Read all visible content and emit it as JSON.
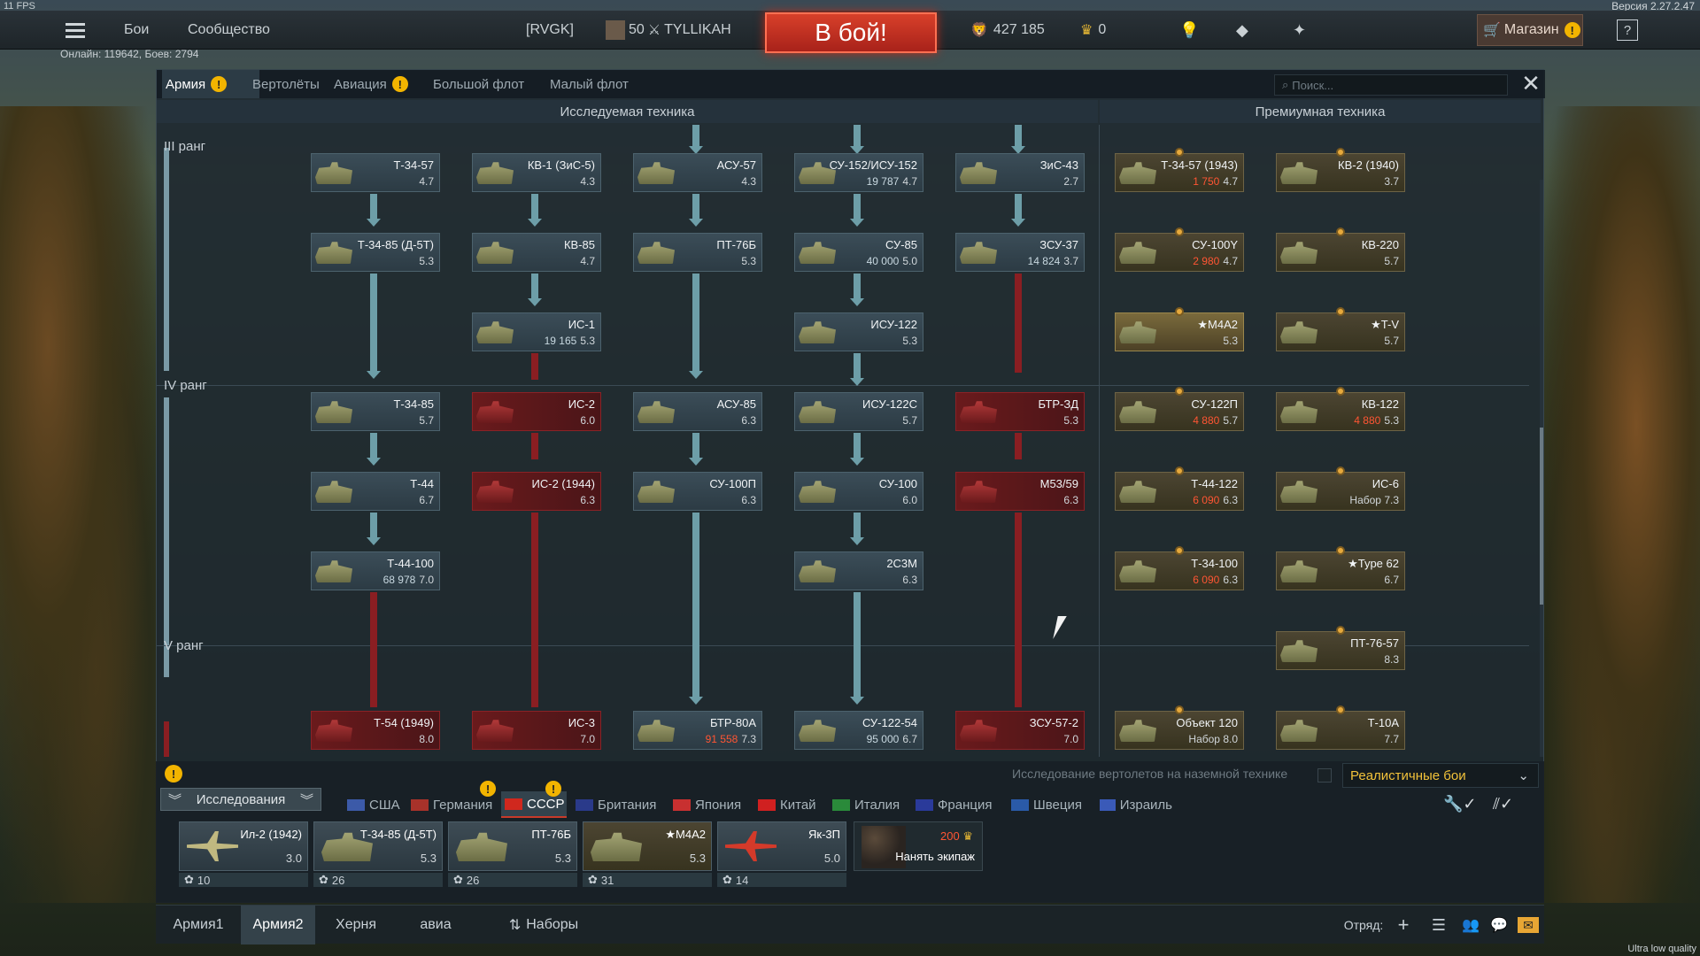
{
  "fps": "11 FPS",
  "version": "Версия 2.27.2.47",
  "topbar": {
    "battles": "Бои",
    "community": "Сообщество",
    "squad_tag": "[RVGK]",
    "level": "50",
    "nickname": "TYLLIKAH",
    "to_battle": "В бой!",
    "silver_lions": "427 185",
    "golden_eagles": "0",
    "shop": "Магазин",
    "help": "?"
  },
  "online": "Онлайн: 119642, Боев: 2794",
  "tabs": [
    {
      "label": "Армия",
      "active": true,
      "warn": true
    },
    {
      "label": "Вертолёты",
      "active": false,
      "warn": false
    },
    {
      "label": "Авиация",
      "active": false,
      "warn": true
    },
    {
      "label": "Большой флот",
      "active": false,
      "warn": false
    },
    {
      "label": "Малый флот",
      "active": false,
      "warn": false
    }
  ],
  "search": {
    "placeholder": "Поиск..."
  },
  "headers": {
    "researched": "Исследуемая техника",
    "premium": "Премиумная техника"
  },
  "ranks": [
    "III ранг",
    "IV ранг",
    "V ранг"
  ],
  "vehicles": [
    {
      "name": "Т-34-57",
      "br": "4.7",
      "col": 0,
      "row": 0,
      "state": "normal"
    },
    {
      "name": "КВ-1 (ЗиС-5)",
      "br": "4.3",
      "col": 1,
      "row": 0,
      "state": "normal"
    },
    {
      "name": "АСУ-57",
      "br": "4.3",
      "col": 2,
      "row": 0,
      "state": "normal"
    },
    {
      "name": "СУ-152/ИСУ-152",
      "br": "4.7",
      "cost": "19 787",
      "col": 3,
      "row": 0,
      "state": "normal"
    },
    {
      "name": "ЗиС-43",
      "br": "2.7",
      "col": 4,
      "row": 0,
      "state": "normal"
    },
    {
      "name": "Т-34-85 (Д-5Т)",
      "br": "5.3",
      "col": 0,
      "row": 1,
      "state": "normal"
    },
    {
      "name": "КВ-85",
      "br": "4.7",
      "col": 1,
      "row": 1,
      "state": "normal"
    },
    {
      "name": "ПТ-76Б",
      "br": "5.3",
      "col": 2,
      "row": 1,
      "state": "normal"
    },
    {
      "name": "СУ-85",
      "br": "5.0",
      "cost": "40 000",
      "col": 3,
      "row": 1,
      "state": "normal"
    },
    {
      "name": "ЗСУ-37",
      "br": "3.7",
      "cost": "14 824",
      "col": 4,
      "row": 1,
      "state": "normal"
    },
    {
      "name": "ИС-1",
      "br": "5.3",
      "cost": "19 165",
      "col": 1,
      "row": 2,
      "state": "normal"
    },
    {
      "name": "ИСУ-122",
      "br": "5.3",
      "col": 3,
      "row": 2,
      "state": "normal"
    },
    {
      "name": "Т-34-85",
      "br": "5.7",
      "col": 0,
      "row": 3,
      "state": "normal"
    },
    {
      "name": "ИС-2",
      "br": "6.0",
      "col": 1,
      "row": 3,
      "state": "red"
    },
    {
      "name": "АСУ-85",
      "br": "6.3",
      "col": 2,
      "row": 3,
      "state": "normal"
    },
    {
      "name": "ИСУ-122С",
      "br": "5.7",
      "col": 3,
      "row": 3,
      "state": "normal"
    },
    {
      "name": "БТР-ЗД",
      "br": "5.3",
      "col": 4,
      "row": 3,
      "state": "red"
    },
    {
      "name": "Т-44",
      "br": "6.7",
      "col": 0,
      "row": 4,
      "state": "normal"
    },
    {
      "name": "ИС-2 (1944)",
      "br": "6.3",
      "col": 1,
      "row": 4,
      "state": "red"
    },
    {
      "name": "СУ-100П",
      "br": "6.3",
      "col": 2,
      "row": 4,
      "state": "normal"
    },
    {
      "name": "СУ-100",
      "br": "6.0",
      "col": 3,
      "row": 4,
      "state": "normal"
    },
    {
      "name": "M53/59",
      "br": "6.3",
      "col": 4,
      "row": 4,
      "state": "red"
    },
    {
      "name": "Т-44-100",
      "br": "7.0",
      "cost": "68 978",
      "col": 0,
      "row": 5,
      "state": "normal"
    },
    {
      "name": "2С3М",
      "br": "6.3",
      "col": 3,
      "row": 5,
      "state": "normal"
    },
    {
      "name": "Т-54 (1949)",
      "br": "8.0",
      "col": 0,
      "row": 7,
      "state": "red"
    },
    {
      "name": "ИС-3",
      "br": "7.0",
      "col": 1,
      "row": 7,
      "state": "red"
    },
    {
      "name": "БТР-80А",
      "br": "7.3",
      "gold": "91 558",
      "col": 2,
      "row": 7,
      "state": "normal"
    },
    {
      "name": "СУ-122-54",
      "br": "6.7",
      "cost": "95 000",
      "col": 3,
      "row": 7,
      "state": "normal"
    },
    {
      "name": "ЗСУ-57-2",
      "br": "7.0",
      "col": 4,
      "row": 7,
      "state": "red"
    }
  ],
  "premium": [
    {
      "name": "Т-34-57 (1943)",
      "br": "4.7",
      "gold": "1 750",
      "col": 0,
      "row": 0
    },
    {
      "name": "КВ-2 (1940)",
      "br": "3.7",
      "col": 1,
      "row": 0
    },
    {
      "name": "СУ-100Y",
      "br": "4.7",
      "gold": "2 980",
      "col": 0,
      "row": 1
    },
    {
      "name": "КВ-220",
      "br": "5.7",
      "col": 1,
      "row": 1
    },
    {
      "name": "★M4A2",
      "br": "5.3",
      "col": 0,
      "row": 2,
      "owned": true
    },
    {
      "name": "★T-V",
      "br": "5.7",
      "col": 1,
      "row": 2
    },
    {
      "name": "СУ-122П",
      "br": "5.7",
      "gold": "4 880",
      "col": 0,
      "row": 3
    },
    {
      "name": "КВ-122",
      "br": "5.3",
      "gold": "4 880",
      "col": 1,
      "row": 3
    },
    {
      "name": "Т-44-122",
      "br": "6.3",
      "gold": "6 090",
      "col": 0,
      "row": 4
    },
    {
      "name": "ИС-6",
      "br": "Набор 7.3",
      "col": 1,
      "row": 4
    },
    {
      "name": "Т-34-100",
      "br": "6.3",
      "gold": "6 090",
      "col": 0,
      "row": 5
    },
    {
      "name": "★Type 62",
      "br": "6.7",
      "col": 1,
      "row": 5
    },
    {
      "name": "ПТ-76-57",
      "br": "8.3",
      "col": 1,
      "row": 6
    },
    {
      "name": "Объект 120",
      "br": "Набор 8.0",
      "col": 0,
      "row": 7
    },
    {
      "name": "Т-10А",
      "br": "7.7",
      "col": 1,
      "row": 7
    }
  ],
  "heli_toggle": "Исследование вертолетов на наземной технике",
  "mode": "Реалистичные бои",
  "research_label": "Исследования",
  "nations": [
    {
      "label": "США",
      "flag": "#3c5aa8",
      "active": false
    },
    {
      "label": "Германия",
      "flag": "#a8322a",
      "active": false
    },
    {
      "label": "СССР",
      "flag": "#d0281e",
      "active": true
    },
    {
      "label": "Британия",
      "flag": "#2a3a8a",
      "active": false
    },
    {
      "label": "Япония",
      "flag": "#c83030",
      "active": false
    },
    {
      "label": "Китай",
      "flag": "#d02020",
      "active": false
    },
    {
      "label": "Италия",
      "flag": "#2a8a3a",
      "active": false
    },
    {
      "label": "Франция",
      "flag": "#2a3a9a",
      "active": false
    },
    {
      "label": "Швеция",
      "flag": "#2a5aa8",
      "active": false
    },
    {
      "label": "Израиль",
      "flag": "#3a5ab8",
      "active": false
    }
  ],
  "crew": [
    {
      "name": "Ил-2 (1942)",
      "br": "3.0",
      "crew": "10",
      "type": "plane"
    },
    {
      "name": "Т-34-85 (Д-5Т)",
      "br": "5.3",
      "crew": "26",
      "type": "tank"
    },
    {
      "name": "ПТ-76Б",
      "br": "5.3",
      "crew": "26",
      "type": "tank"
    },
    {
      "name": "★M4A2",
      "br": "5.3",
      "crew": "31",
      "type": "tank-prem"
    },
    {
      "name": "Як-3П",
      "br": "5.0",
      "crew": "14",
      "type": "plane-red"
    }
  ],
  "hire": {
    "cost": "200",
    "label": "Нанять экипаж"
  },
  "footer": {
    "presets": [
      "Армия1",
      "Армия2",
      "Херня",
      "авиа"
    ],
    "active": 1,
    "sets": "Наборы",
    "squad": "Отряд:"
  },
  "quality": "Ultra low quality"
}
